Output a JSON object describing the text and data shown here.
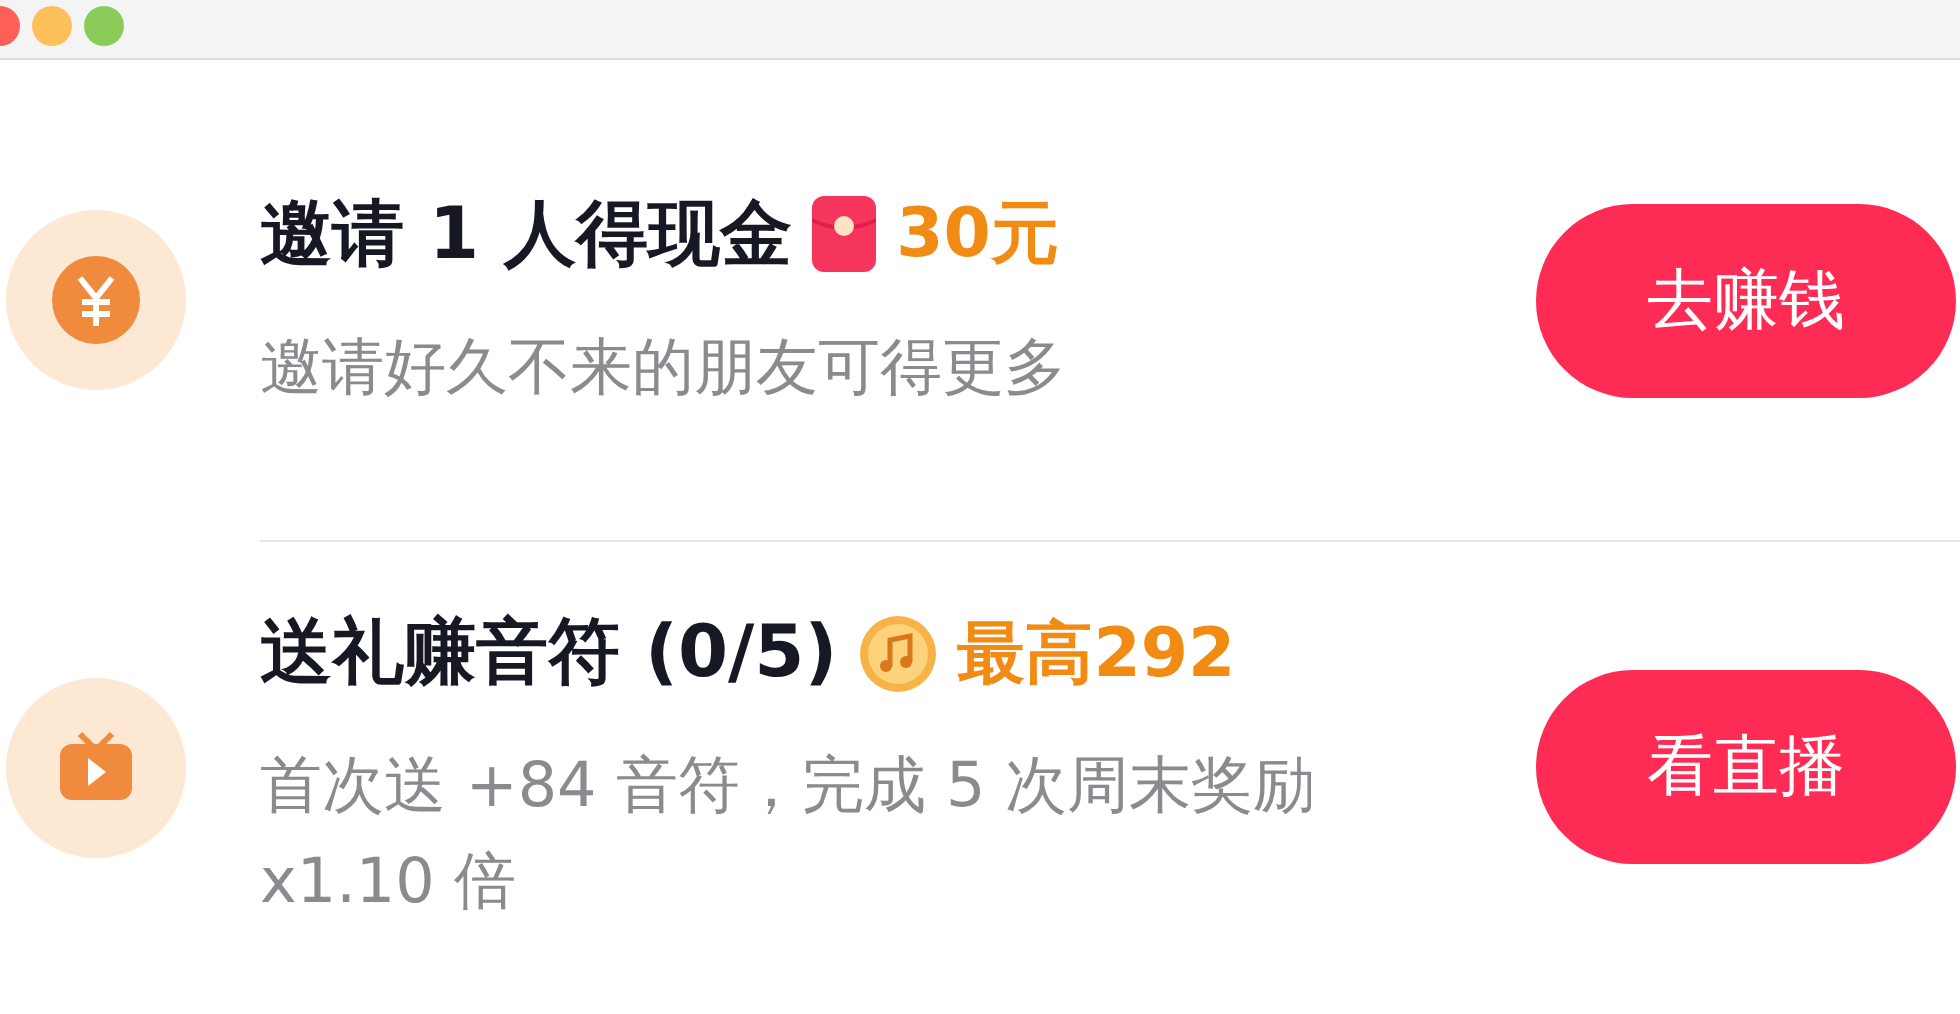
{
  "tasks": [
    {
      "icon": {
        "kind": "yen"
      },
      "title": "邀请 1 人得现金",
      "reward": {
        "kind": "envelope",
        "text": "30元"
      },
      "subtitle": "邀请好久不来的朋友可得更多",
      "button": "去赚钱"
    },
    {
      "icon": {
        "kind": "tv"
      },
      "title": "送礼赚音符 (0/5)",
      "reward": {
        "kind": "note",
        "text": "最高292"
      },
      "subtitle": "首次送 +84 音符，完成 5 次周末奖励 x1.10 倍",
      "button": "看直播"
    }
  ]
}
